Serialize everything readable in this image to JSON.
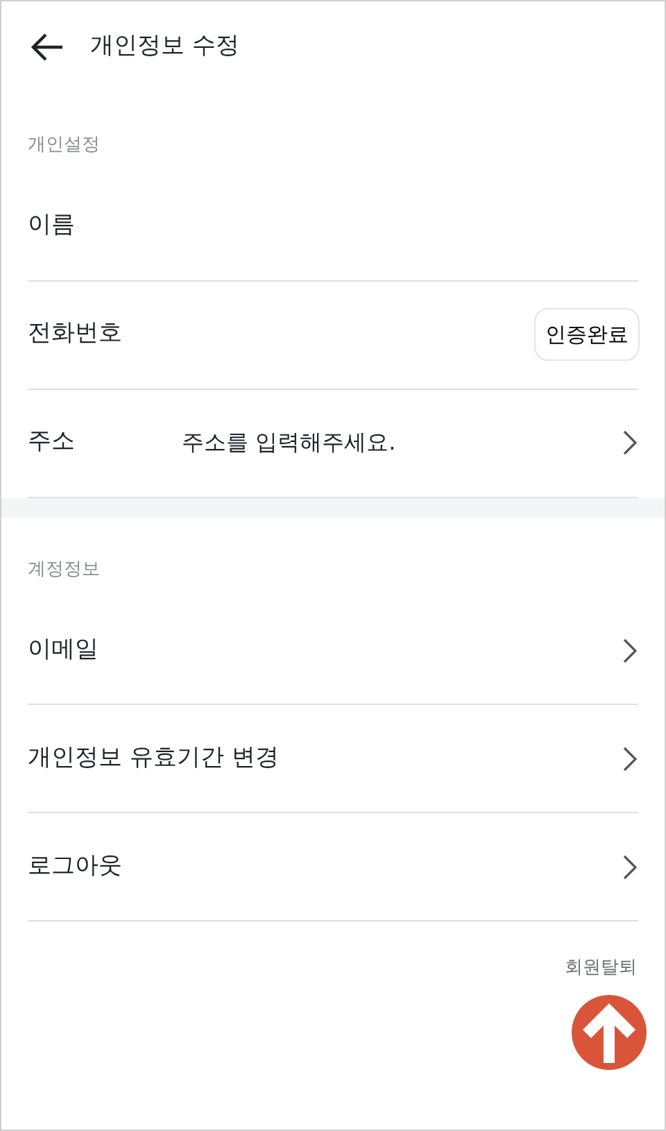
{
  "header": {
    "title": "개인정보 수정"
  },
  "sections": [
    {
      "title": "개인설정",
      "rows": [
        {
          "kind": "plain",
          "label": "이름"
        },
        {
          "kind": "badge",
          "label": "전화번호",
          "badge": "인증완료"
        },
        {
          "kind": "link",
          "label": "주소",
          "placeholder": "주소를 입력해주세요."
        }
      ]
    },
    {
      "title": "계정정보",
      "rows": [
        {
          "kind": "link",
          "label": "이메일"
        },
        {
          "kind": "link",
          "label": "개인정보 유효기간 변경"
        },
        {
          "kind": "link",
          "label": "로그아웃"
        }
      ]
    }
  ],
  "withdraw": "회원탈퇴"
}
